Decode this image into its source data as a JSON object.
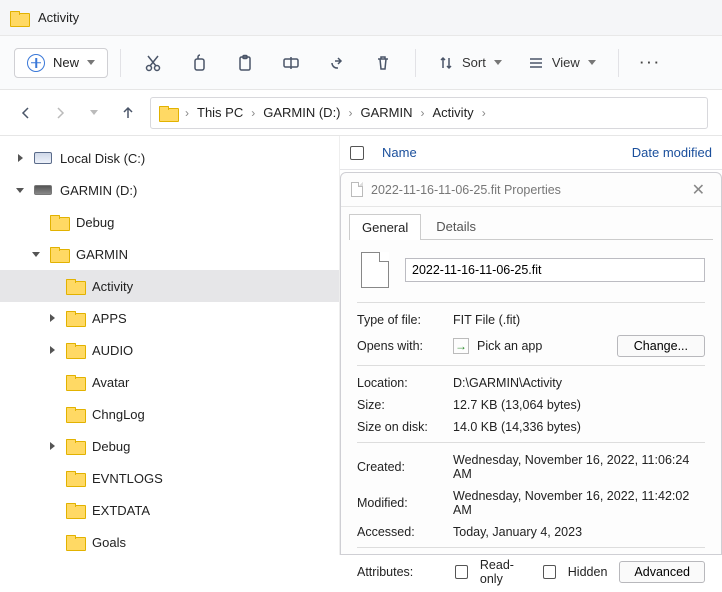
{
  "window": {
    "title": "Activity"
  },
  "toolbar": {
    "new_label": "New",
    "sort_label": "Sort",
    "view_label": "View"
  },
  "breadcrumbs": {
    "items": [
      "This PC",
      "GARMIN (D:)",
      "GARMIN",
      "Activity"
    ]
  },
  "sidebar": {
    "local_disk": "Local Disk (C:)",
    "garmin_d": "GARMIN (D:)",
    "debug1": "Debug",
    "garmin": "GARMIN",
    "activity": "Activity",
    "apps": "APPS",
    "audio": "AUDIO",
    "avatar": "Avatar",
    "chnglog": "ChngLog",
    "debug2": "Debug",
    "evntlogs": "EVNTLOGS",
    "extdata": "EXTDATA",
    "goals": "Goals"
  },
  "columns": {
    "name": "Name",
    "date": "Date modified"
  },
  "props": {
    "title": "2022-11-16-11-06-25.fit Properties",
    "tab_general": "General",
    "tab_details": "Details",
    "filename": "2022-11-16-11-06-25.fit",
    "type_of_file_k": "Type of file:",
    "type_of_file_v": "FIT File (.fit)",
    "opens_with_k": "Opens with:",
    "opens_with_v": "Pick an app",
    "change_btn": "Change...",
    "location_k": "Location:",
    "location_v": "D:\\GARMIN\\Activity",
    "size_k": "Size:",
    "size_v": "12.7 KB (13,064 bytes)",
    "size_on_disk_k": "Size on disk:",
    "size_on_disk_v": "14.0 KB (14,336 bytes)",
    "created_k": "Created:",
    "created_v": "Wednesday, November 16, 2022, 11:06:24 AM",
    "modified_k": "Modified:",
    "modified_v": "Wednesday, November 16, 2022, 11:42:02 AM",
    "accessed_k": "Accessed:",
    "accessed_v": "Today, January 4, 2023",
    "attributes_k": "Attributes:",
    "readonly": "Read-only",
    "hidden": "Hidden",
    "advanced": "Advanced"
  }
}
